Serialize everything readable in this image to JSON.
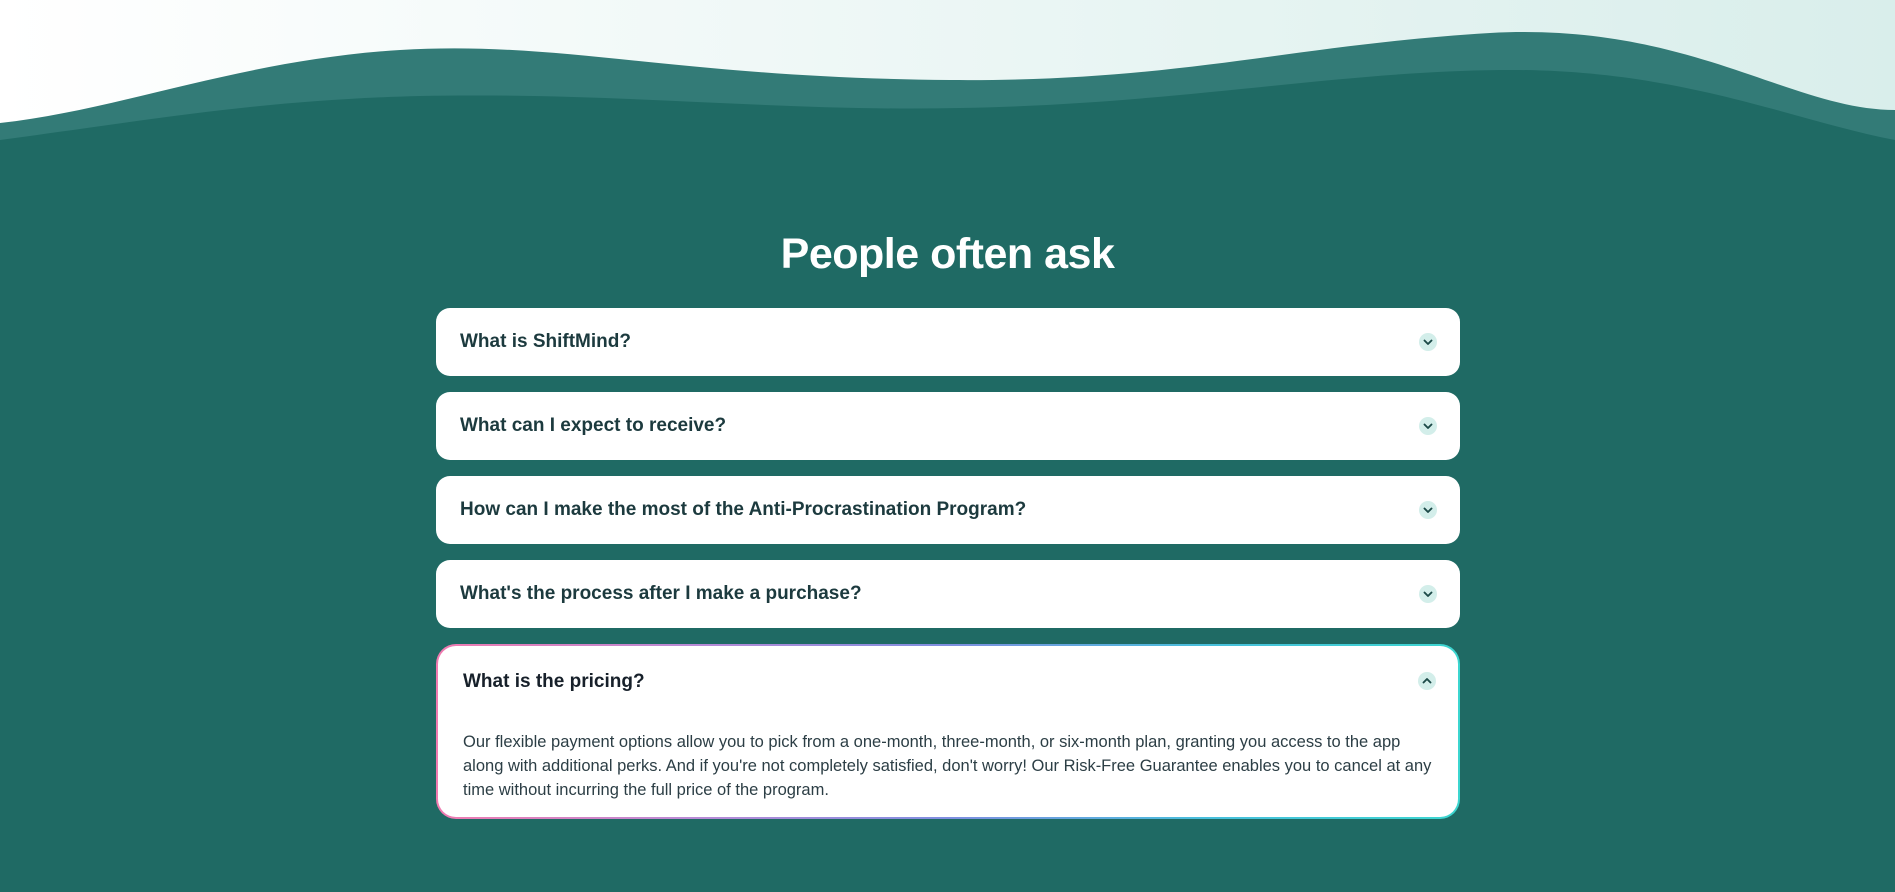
{
  "faq": {
    "title": "People often ask",
    "items": [
      {
        "question": "What is ShiftMind?",
        "expanded": false
      },
      {
        "question": "What can I expect to receive?",
        "expanded": false
      },
      {
        "question": "How can I make the most of the Anti-Procrastination Program?",
        "expanded": false
      },
      {
        "question": "What's the process after I make a purchase?",
        "expanded": false
      },
      {
        "question": "What is the pricing?",
        "expanded": true,
        "answer": "Our flexible payment options allow you to pick from a one-month, three-month, or six-month plan, granting you access to the app along with additional perks. And if you're not completely satisfied, don't worry! Our Risk-Free Guarantee enables you to cancel at any time without incurring the full price of the program."
      }
    ]
  },
  "icons": {
    "collapsed": "chevron-down-icon",
    "expanded": "chevron-up-icon"
  },
  "colors": {
    "background": "#1f6a64",
    "wave_light": "#337b77",
    "card": "#ffffff",
    "question_text": "#1c3a3e",
    "chevron_bg": "#d3eeea",
    "active_border_start": "#f07bb0",
    "active_border_end": "#3cd6d0"
  }
}
